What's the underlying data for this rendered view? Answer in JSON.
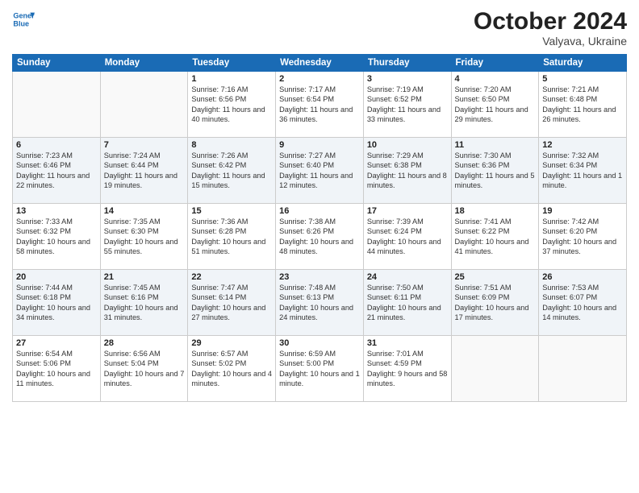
{
  "header": {
    "logo_line1": "General",
    "logo_line2": "Blue",
    "month": "October 2024",
    "location": "Valyava, Ukraine"
  },
  "weekdays": [
    "Sunday",
    "Monday",
    "Tuesday",
    "Wednesday",
    "Thursday",
    "Friday",
    "Saturday"
  ],
  "weeks": [
    [
      {
        "day": "",
        "info": ""
      },
      {
        "day": "",
        "info": ""
      },
      {
        "day": "1",
        "info": "Sunrise: 7:16 AM\nSunset: 6:56 PM\nDaylight: 11 hours and 40 minutes."
      },
      {
        "day": "2",
        "info": "Sunrise: 7:17 AM\nSunset: 6:54 PM\nDaylight: 11 hours and 36 minutes."
      },
      {
        "day": "3",
        "info": "Sunrise: 7:19 AM\nSunset: 6:52 PM\nDaylight: 11 hours and 33 minutes."
      },
      {
        "day": "4",
        "info": "Sunrise: 7:20 AM\nSunset: 6:50 PM\nDaylight: 11 hours and 29 minutes."
      },
      {
        "day": "5",
        "info": "Sunrise: 7:21 AM\nSunset: 6:48 PM\nDaylight: 11 hours and 26 minutes."
      }
    ],
    [
      {
        "day": "6",
        "info": "Sunrise: 7:23 AM\nSunset: 6:46 PM\nDaylight: 11 hours and 22 minutes."
      },
      {
        "day": "7",
        "info": "Sunrise: 7:24 AM\nSunset: 6:44 PM\nDaylight: 11 hours and 19 minutes."
      },
      {
        "day": "8",
        "info": "Sunrise: 7:26 AM\nSunset: 6:42 PM\nDaylight: 11 hours and 15 minutes."
      },
      {
        "day": "9",
        "info": "Sunrise: 7:27 AM\nSunset: 6:40 PM\nDaylight: 11 hours and 12 minutes."
      },
      {
        "day": "10",
        "info": "Sunrise: 7:29 AM\nSunset: 6:38 PM\nDaylight: 11 hours and 8 minutes."
      },
      {
        "day": "11",
        "info": "Sunrise: 7:30 AM\nSunset: 6:36 PM\nDaylight: 11 hours and 5 minutes."
      },
      {
        "day": "12",
        "info": "Sunrise: 7:32 AM\nSunset: 6:34 PM\nDaylight: 11 hours and 1 minute."
      }
    ],
    [
      {
        "day": "13",
        "info": "Sunrise: 7:33 AM\nSunset: 6:32 PM\nDaylight: 10 hours and 58 minutes."
      },
      {
        "day": "14",
        "info": "Sunrise: 7:35 AM\nSunset: 6:30 PM\nDaylight: 10 hours and 55 minutes."
      },
      {
        "day": "15",
        "info": "Sunrise: 7:36 AM\nSunset: 6:28 PM\nDaylight: 10 hours and 51 minutes."
      },
      {
        "day": "16",
        "info": "Sunrise: 7:38 AM\nSunset: 6:26 PM\nDaylight: 10 hours and 48 minutes."
      },
      {
        "day": "17",
        "info": "Sunrise: 7:39 AM\nSunset: 6:24 PM\nDaylight: 10 hours and 44 minutes."
      },
      {
        "day": "18",
        "info": "Sunrise: 7:41 AM\nSunset: 6:22 PM\nDaylight: 10 hours and 41 minutes."
      },
      {
        "day": "19",
        "info": "Sunrise: 7:42 AM\nSunset: 6:20 PM\nDaylight: 10 hours and 37 minutes."
      }
    ],
    [
      {
        "day": "20",
        "info": "Sunrise: 7:44 AM\nSunset: 6:18 PM\nDaylight: 10 hours and 34 minutes."
      },
      {
        "day": "21",
        "info": "Sunrise: 7:45 AM\nSunset: 6:16 PM\nDaylight: 10 hours and 31 minutes."
      },
      {
        "day": "22",
        "info": "Sunrise: 7:47 AM\nSunset: 6:14 PM\nDaylight: 10 hours and 27 minutes."
      },
      {
        "day": "23",
        "info": "Sunrise: 7:48 AM\nSunset: 6:13 PM\nDaylight: 10 hours and 24 minutes."
      },
      {
        "day": "24",
        "info": "Sunrise: 7:50 AM\nSunset: 6:11 PM\nDaylight: 10 hours and 21 minutes."
      },
      {
        "day": "25",
        "info": "Sunrise: 7:51 AM\nSunset: 6:09 PM\nDaylight: 10 hours and 17 minutes."
      },
      {
        "day": "26",
        "info": "Sunrise: 7:53 AM\nSunset: 6:07 PM\nDaylight: 10 hours and 14 minutes."
      }
    ],
    [
      {
        "day": "27",
        "info": "Sunrise: 6:54 AM\nSunset: 5:06 PM\nDaylight: 10 hours and 11 minutes."
      },
      {
        "day": "28",
        "info": "Sunrise: 6:56 AM\nSunset: 5:04 PM\nDaylight: 10 hours and 7 minutes."
      },
      {
        "day": "29",
        "info": "Sunrise: 6:57 AM\nSunset: 5:02 PM\nDaylight: 10 hours and 4 minutes."
      },
      {
        "day": "30",
        "info": "Sunrise: 6:59 AM\nSunset: 5:00 PM\nDaylight: 10 hours and 1 minute."
      },
      {
        "day": "31",
        "info": "Sunrise: 7:01 AM\nSunset: 4:59 PM\nDaylight: 9 hours and 58 minutes."
      },
      {
        "day": "",
        "info": ""
      },
      {
        "day": "",
        "info": ""
      }
    ]
  ]
}
